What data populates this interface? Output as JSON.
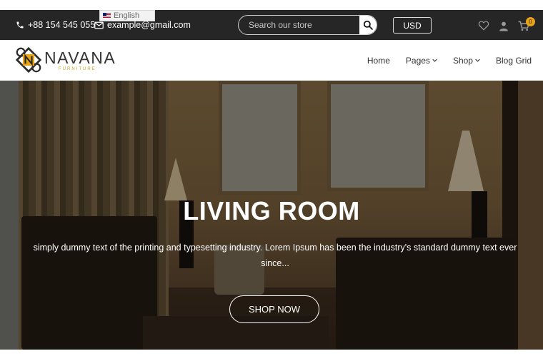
{
  "topbar": {
    "phone": "+88 154 545 055",
    "email": "example@gmail.com",
    "language": "English",
    "search_placeholder": "Search our store",
    "currency": "USD",
    "cart_count": "0",
    "icons": [
      "phone-icon",
      "mail-icon",
      "search-icon",
      "heart-icon",
      "user-icon",
      "cart-icon"
    ]
  },
  "header": {
    "logo_name": "NAVANA",
    "logo_sub": "FURNITURE",
    "nav": [
      {
        "label": "Home",
        "dropdown": false
      },
      {
        "label": "Pages",
        "dropdown": true
      },
      {
        "label": "Shop",
        "dropdown": true
      },
      {
        "label": "Blog Grid",
        "dropdown": false
      }
    ]
  },
  "hero": {
    "title": "LIVING ROOM",
    "text": "simply dummy text of the printing and typesetting industry. Lorem Ipsum has been the industry's standard dummy text ever since...",
    "button": "SHOP NOW"
  },
  "colors": {
    "topbar_bg": "#262626",
    "accent": "#e8a317",
    "text_dark": "#333333"
  }
}
